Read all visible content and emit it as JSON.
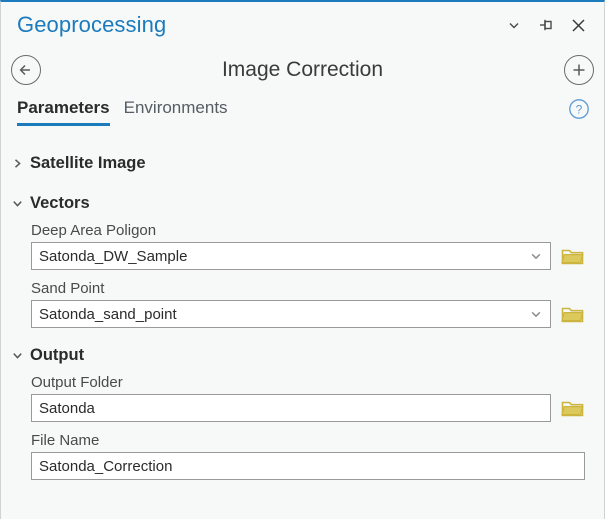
{
  "window": {
    "title": "Geoprocessing",
    "controls": [
      {
        "name": "chevron-down-icon",
        "label": "Minimize / dropdown"
      },
      {
        "name": "pin-icon",
        "label": "Auto Hide"
      },
      {
        "name": "close-icon",
        "label": "Close"
      }
    ]
  },
  "tool_header": {
    "back_label": "Back",
    "title": "Image Correction",
    "add_label": "Add"
  },
  "tabs": {
    "items": [
      {
        "label": "Parameters",
        "active": true
      },
      {
        "label": "Environments",
        "active": false
      }
    ],
    "help_label": "Help"
  },
  "sections": [
    {
      "title": "Satellite Image",
      "expanded": false,
      "chevron": "chevron-right-icon",
      "fields": []
    },
    {
      "title": "Vectors",
      "expanded": true,
      "chevron": "chevron-down-icon",
      "fields": [
        {
          "label": "Deep Area Poligon",
          "value": "Satonda_DW_Sample",
          "placeholder": "",
          "type": "combo",
          "browse": true
        },
        {
          "label": "Sand Point",
          "value": "Satonda_sand_point",
          "placeholder": "",
          "type": "combo",
          "browse": true
        }
      ]
    },
    {
      "title": "Output",
      "expanded": true,
      "chevron": "chevron-down-icon",
      "fields": [
        {
          "label": "Output Folder",
          "value": "Satonda",
          "placeholder": "",
          "type": "text",
          "browse": true
        },
        {
          "label": "File Name",
          "value": "Satonda_Correction",
          "placeholder": "",
          "type": "text",
          "browse": false
        }
      ]
    }
  ],
  "colors": {
    "accent": "#1b7bbd",
    "panel_bg": "#f7f8f8",
    "folder_icon": "#d6bf4a",
    "text_primary": "#2b2b2b",
    "text_secondary": "#4a4a4a",
    "input_border": "#9a9a9a"
  }
}
